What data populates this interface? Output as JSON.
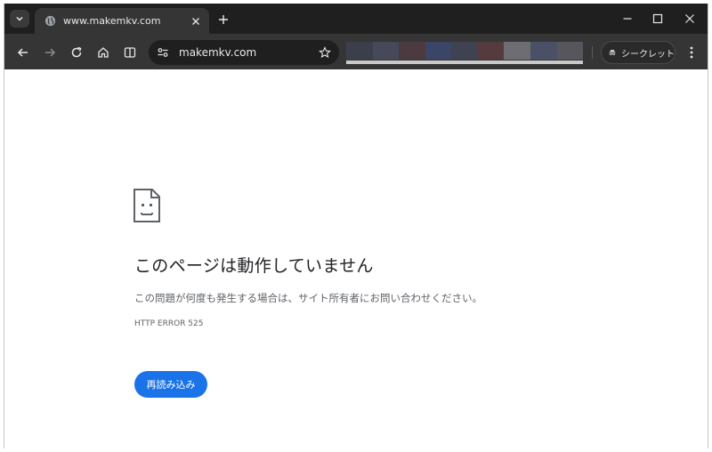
{
  "tab": {
    "title": "www.makemkv.com",
    "favicon": "globe-icon"
  },
  "toolbar": {
    "url": "makemkv.com",
    "incognito_label": "シークレット"
  },
  "page": {
    "heading": "このページは動作していません",
    "description": "この問題が何度も発生する場合は、サイト所有者にお問い合わせください。",
    "error_code": "HTTP ERROR 525",
    "reload_label": "再読み込み"
  },
  "colors": {
    "tab_strip": "#1f1f1f",
    "toolbar": "#353535",
    "omnibox": "#1f1f1f",
    "button_primary": "#1a73e8",
    "heading_text": "#202124",
    "secondary_text": "#5f6368",
    "bookmark_blur": [
      "#3a3f4a",
      "#45495a",
      "#4b3b40",
      "#3b4566",
      "#3f4250",
      "#553b3e",
      "#6e6e72",
      "#4a5066",
      "#56565c"
    ]
  }
}
